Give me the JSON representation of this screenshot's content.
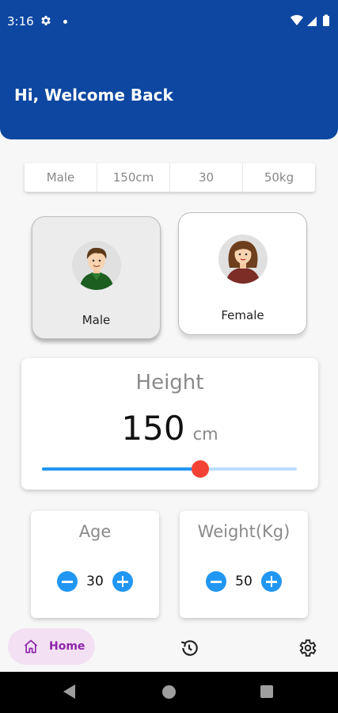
{
  "status_bar": {
    "time": "3:16"
  },
  "header": {
    "greeting": "Hi, Welcome Back"
  },
  "summary": {
    "gender": "Male",
    "height": "150cm",
    "age": "30",
    "weight": "50kg"
  },
  "gender_options": [
    {
      "label": "Male",
      "selected": true
    },
    {
      "label": "Female",
      "selected": false
    }
  ],
  "height": {
    "title": "Height",
    "value": "150",
    "unit": "cm",
    "slider_fraction": 0.62
  },
  "age": {
    "title": "Age",
    "value": "30"
  },
  "weight": {
    "title": "Weight(Kg)",
    "value": "50"
  },
  "bottom_nav": {
    "home_label": "Home"
  },
  "colors": {
    "header": "#0d47a1",
    "accent": "#2196f3",
    "slider_thumb": "#f44336",
    "nav_active": "#8e24aa",
    "nav_active_bg": "#f3e1f3"
  },
  "icons": {
    "status": [
      "gear-icon",
      "wifi-icon",
      "signal-icon",
      "battery-icon"
    ],
    "nav": [
      "home-icon",
      "history-icon",
      "settings-icon"
    ]
  }
}
